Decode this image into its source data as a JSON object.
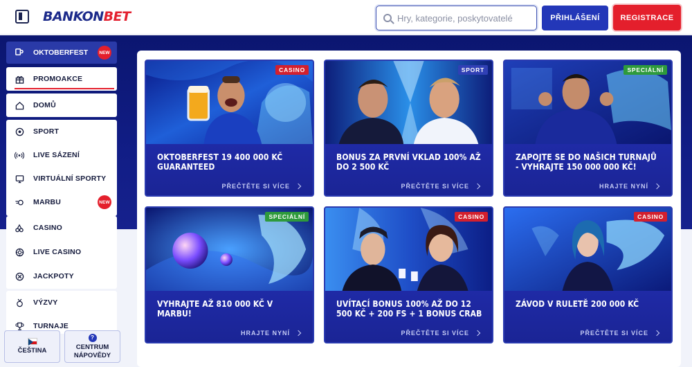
{
  "header": {
    "logo_part1": "BANKON",
    "logo_part2": "BET",
    "search_placeholder": "Hry, kategorie, poskytovatelé",
    "login_label": "PŘIHLÁŠENÍ",
    "register_label": "REGISTRACE"
  },
  "sidebar": {
    "featured": {
      "label": "OKTOBERFEST",
      "badge": "NEW"
    },
    "promo": {
      "label": "PROMOAKCE"
    },
    "home": {
      "label": "DOMŮ"
    },
    "sport_items": [
      {
        "label": "SPORT",
        "icon": "soccer-ball-icon"
      },
      {
        "label": "LIVE SÁZENÍ",
        "icon": "broadcast-icon"
      },
      {
        "label": "VIRTUÁLNÍ SPORTY",
        "icon": "monitor-icon"
      },
      {
        "label": "MARBU",
        "icon": "marbu-icon",
        "badge": "NEW"
      }
    ],
    "casino_items": [
      {
        "label": "CASINO",
        "icon": "cherries-icon"
      },
      {
        "label": "LIVE CASINO",
        "icon": "chip-icon"
      },
      {
        "label": "JACKPOTY",
        "icon": "jackpot-icon"
      }
    ],
    "extra_items": [
      {
        "label": "VÝZVY",
        "icon": "medal-icon"
      },
      {
        "label": "TURNAJE",
        "icon": "trophy-icon"
      }
    ],
    "language_label": "ČEŠTINA",
    "help_label_1": "CENTRUM",
    "help_label_2": "NÁPOVĚDY"
  },
  "cards": [
    {
      "tag": "CASINO",
      "title": "OKTOBERFEST 19 400 000 KČ GUARANTEED",
      "link": "PŘEČTĚTE SI VÍCE"
    },
    {
      "tag": "SPORT",
      "title": "BONUS ZA PRVNÍ VKLAD 100% AŽ DO 2 500 KČ",
      "link": "PŘEČTĚTE SI VÍCE"
    },
    {
      "tag": "SPECIÁLNÍ",
      "title": "ZAPOJTE SE DO NAŠICH TURNAJŮ - VYHRAJTE 150 000 000 KČ!",
      "link": "HRAJTE NYNÍ"
    },
    {
      "tag": "SPECIÁLNÍ",
      "title": "VYHRAJTE AŽ 810 000 KČ V MARBU!",
      "link": "HRAJTE NYNÍ"
    },
    {
      "tag": "CASINO",
      "title": "UVÍTACÍ BONUS 100% AŽ DO 12 500 KČ + 200 FS + 1 BONUS CRAB",
      "link": "PŘEČTĚTE SI VÍCE"
    },
    {
      "tag": "CASINO",
      "title": "ZÁVOD V RULETĚ 200 000 KČ",
      "link": "PŘEČTĚTE SI VÍCE"
    }
  ],
  "colors": {
    "brand_blue": "#2337b8",
    "brand_red": "#e41f2c",
    "tag_casino": "#d3202e",
    "tag_sport": "#3040b5",
    "tag_special": "#2e9a3c"
  }
}
